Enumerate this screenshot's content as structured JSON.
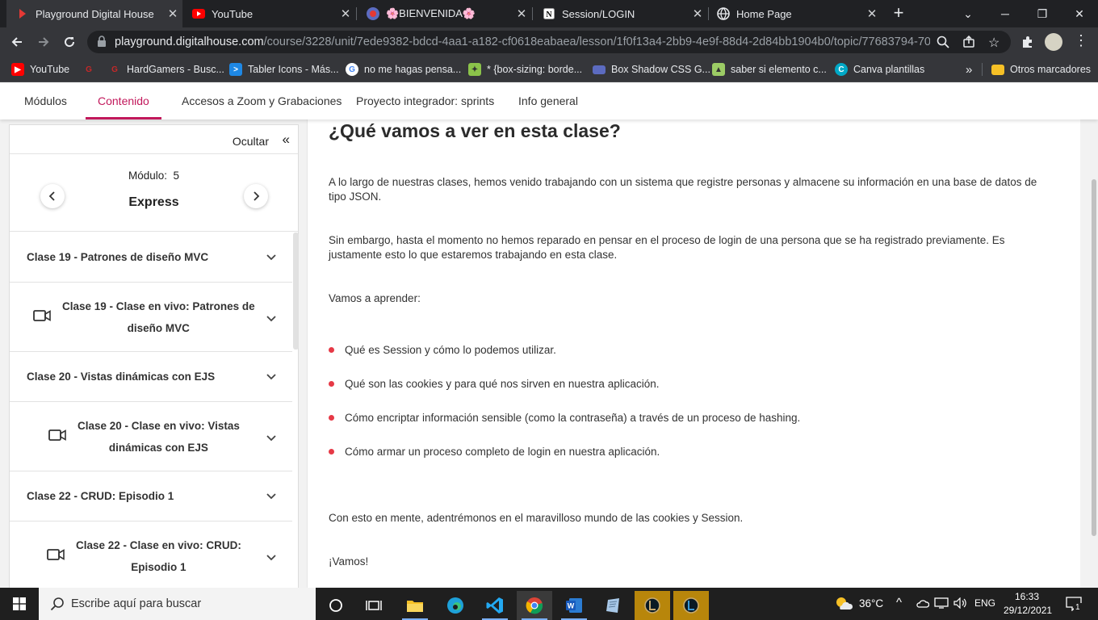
{
  "browser": {
    "tabs": [
      {
        "title": "Playground Digital House",
        "favicon": "digitalhouse-icon",
        "active": true
      },
      {
        "title": "YouTube",
        "favicon": "youtube-icon",
        "active": false
      },
      {
        "title": "🌸BIENVENIDA🌸",
        "favicon": "app-icon",
        "active": false
      },
      {
        "title": "Session/LOGIN",
        "favicon": "notion-icon",
        "active": false
      },
      {
        "title": "Home Page",
        "favicon": "globe-icon",
        "active": false
      }
    ],
    "url_host": "playground.digitalhouse.com",
    "url_path": "/course/3228/unit/7ede9382-bdcd-4aa1-a182-cf0618eabaea/lesson/1f0f13a4-2bb9-4e9f-88d4-2d84bb1904b0/topic/77683794-70b...",
    "bookmarks": [
      {
        "label": "YouTube",
        "icon": "youtube-icon"
      },
      {
        "label": "",
        "icon": "g-icon"
      },
      {
        "label": "HardGamers - Busc...",
        "icon": "hardgamers-icon"
      },
      {
        "label": "Tabler Icons - Más...",
        "icon": "tabler-icon"
      },
      {
        "label": "no me hagas pensa...",
        "icon": "google-icon"
      },
      {
        "label": "* {box-sizing: borde...",
        "icon": "bookmark-icon"
      },
      {
        "label": "Box Shadow CSS G...",
        "icon": "folder-icon"
      },
      {
        "label": "saber si elemento c...",
        "icon": "bookmark-icon"
      },
      {
        "label": "Canva plantillas",
        "icon": "canva-icon"
      }
    ],
    "bookmarks_more": "»",
    "other_bookmarks": "Otros marcadores"
  },
  "site_nav": {
    "items": [
      "Módulos",
      "Contenido",
      "Accesos a Zoom y Grabaciones",
      "Proyecto integrador: sprints",
      "Info general"
    ],
    "active": "Contenido"
  },
  "sidebar": {
    "hide_label": "Ocultar",
    "hide_icon": "«",
    "module_label": "Módulo:",
    "module_number": "5",
    "module_name": "Express",
    "items": [
      {
        "type": "section",
        "label": "Clase 19 - Patrones de diseño MVC"
      },
      {
        "type": "video",
        "line1": "Clase 19 - Clase en vivo: Patrones de",
        "line2": "diseño MVC"
      },
      {
        "type": "section",
        "label": "Clase 20 - Vistas dinámicas con EJS"
      },
      {
        "type": "video",
        "line1": "Clase 20 - Clase en vivo: Vistas",
        "line2": "dinámicas con EJS"
      },
      {
        "type": "section",
        "label": "Clase 22 - CRUD: Episodio 1"
      },
      {
        "type": "video",
        "line1": "Clase 22 - Clase en vivo: CRUD:",
        "line2": "Episodio 1"
      }
    ]
  },
  "content": {
    "title": "¿Qué vamos a ver en esta clase?",
    "p1": "A lo largo de nuestras clases, hemos venido trabajando con un sistema que registre personas y almacene su información en una base de datos de tipo JSON.",
    "p2": "Sin embargo, hasta el momento no hemos reparado en pensar en el proceso de login de una persona que se ha registrado previamente. Es justamente esto lo que estaremos trabajando en esta clase.",
    "p3": "Vamos a aprender:",
    "bullets": [
      "Qué es Session y cómo lo podemos utilizar.",
      "Qué son las cookies y para qué nos sirven en nuestra aplicación.",
      "Cómo encriptar información sensible (como la contraseña) a través de un proceso de hashing.",
      "Cómo armar un proceso completo de login en nuestra aplicación."
    ],
    "p4": "Con esto en mente, adentrémonos en el maravilloso mundo de las cookies y Session.",
    "p5": "¡Vamos!"
  },
  "taskbar": {
    "search_placeholder": "Escribe aquí para buscar",
    "weather": "36°C",
    "lang": "ENG",
    "time": "16:33",
    "date": "29/12/2021",
    "notifications": "1"
  },
  "colors": {
    "accent": "#c2185b",
    "bullet": "#e63946"
  }
}
